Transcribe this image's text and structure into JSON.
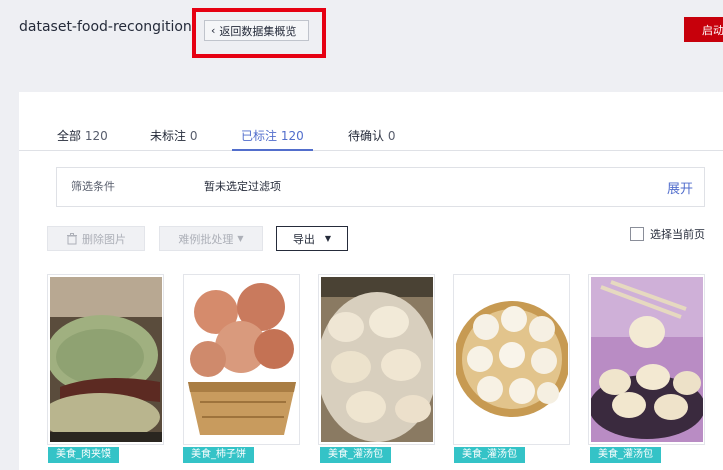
{
  "header": {
    "dataset_name": "dataset-food-recongition",
    "back_label": "返回数据集概览",
    "start_label": "启动"
  },
  "tabs": [
    {
      "label": "全部",
      "count": "120"
    },
    {
      "label": "未标注",
      "count": "0"
    },
    {
      "label": "已标注",
      "count": "120"
    },
    {
      "label": "待确认",
      "count": "0"
    }
  ],
  "filter": {
    "label": "筛选条件",
    "value": "暂未选定过滤项",
    "expand_label": "展开"
  },
  "toolbar": {
    "delete_label": "删除图片",
    "batch_label": "难例批处理",
    "export_label": "导出",
    "select_current_label": "选择当前页"
  },
  "images": [
    {
      "tag": "美食_肉夹馍",
      "icon": "roujiamo-photo"
    },
    {
      "tag": "美食_柿子饼",
      "icon": "persimmon-cake-photo"
    },
    {
      "tag": "美食_灌汤包",
      "icon": "soup-dumpling-photo"
    },
    {
      "tag": "美食_灌汤包",
      "icon": "soup-dumpling-steamer-photo"
    },
    {
      "tag": "美食_灌汤包",
      "icon": "soup-dumpling-chopsticks-photo"
    }
  ],
  "colors": {
    "accent": "#526ecc",
    "start_button": "#c7000b",
    "tag": "#34c3c7",
    "highlight": "#e60012"
  }
}
